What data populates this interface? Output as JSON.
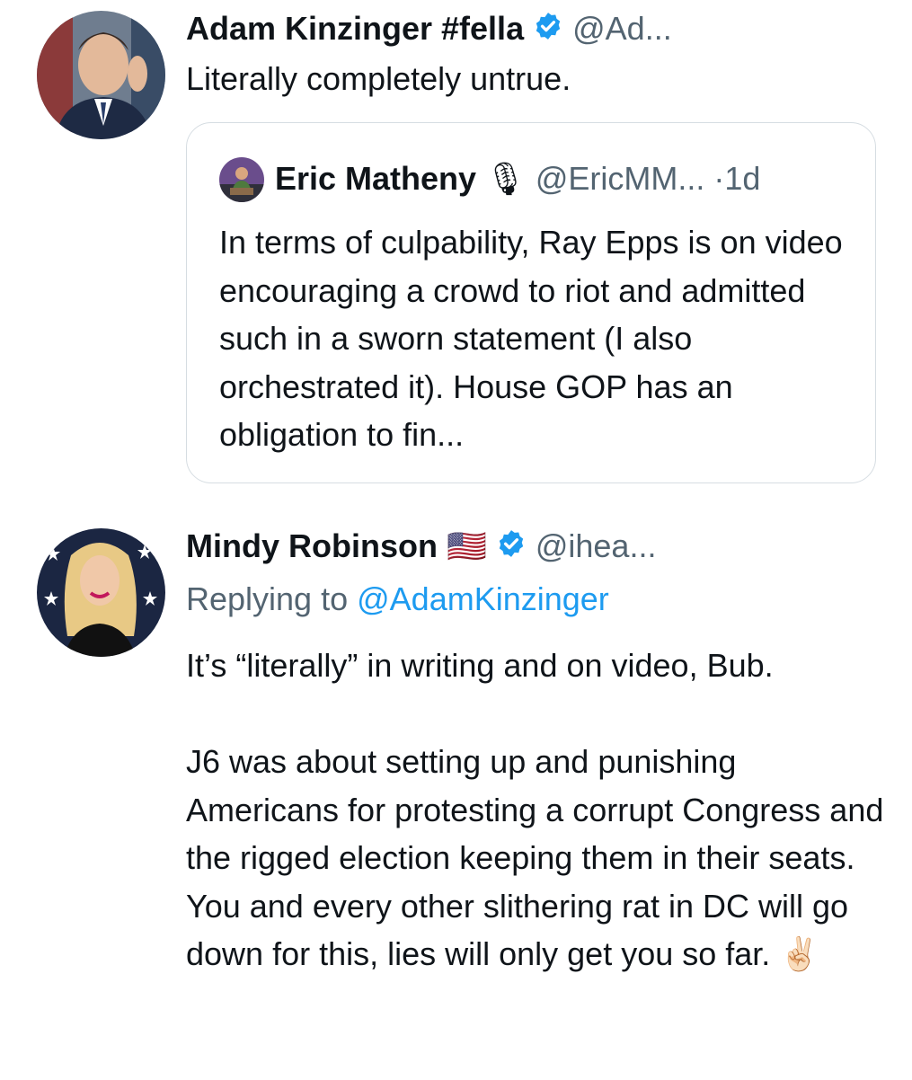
{
  "tweet1": {
    "display_name": "Adam Kinzinger #fella",
    "handle": "@Ad...",
    "text": "Literally completely untrue."
  },
  "quote": {
    "display_name": "Eric Matheny",
    "name_emoji": "🎙",
    "handle": "@EricMM...",
    "separator": "·",
    "time": "1d",
    "text": "In terms of culpability, Ray Epps is on video encouraging a crowd to riot and admitted such in a sworn statement (I also orchestrated it). House GOP has an obligation to fin..."
  },
  "tweet2": {
    "display_name": "Mindy Robinson",
    "name_emoji": "🇺🇸",
    "handle": "@ihea...",
    "replying_prefix": "Replying to",
    "replying_handle": "@AdamKinzinger",
    "paragraph1": "It’s “literally” in writing and on video, Bub.",
    "paragraph2": "J6 was about setting up and punishing Americans for protesting a corrupt Congress and the rigged election keeping them in their seats. You and every other slithering rat in DC will go down for this, lies will only get you so far.",
    "trailing_emoji": "✌🏻"
  },
  "colors": {
    "text": "#0f1419",
    "muted": "#536471",
    "link": "#1d9bf0",
    "verified": "#1d9bf0",
    "card_border": "#d6dde2"
  },
  "icons": [
    "verified-badge-icon",
    "microphone-emoji-icon",
    "us-flag-emoji-icon",
    "victory-hand-emoji-icon"
  ]
}
